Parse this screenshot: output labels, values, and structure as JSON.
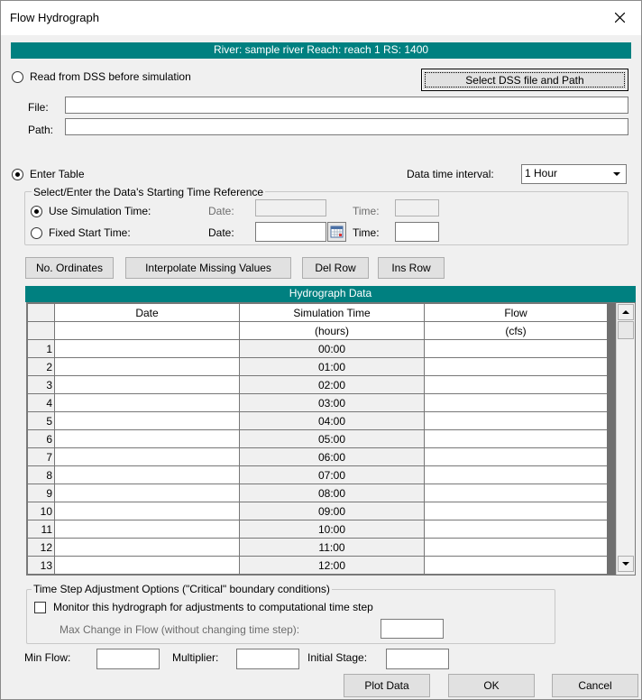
{
  "window": {
    "title": "Flow Hydrograph"
  },
  "header": {
    "location": "River: sample river  Reach: reach 1  RS: 1400"
  },
  "dss": {
    "radio_label": "Read from DSS before simulation",
    "select_button": "Select DSS file and Path",
    "file_label": "File:",
    "file_value": "",
    "path_label": "Path:",
    "path_value": ""
  },
  "enter_table": {
    "radio_label": "Enter Table",
    "interval_label": "Data time interval:",
    "interval_value": "1 Hour"
  },
  "time_ref": {
    "group_title": "Select/Enter the Data's Starting Time Reference",
    "use_sim_label": "Use Simulation Time:",
    "fixed_label": "Fixed Start Time:",
    "date_label": "Date:",
    "time_label": "Time:"
  },
  "toolbar": {
    "ordinates": "No. Ordinates",
    "interpolate": "Interpolate Missing Values",
    "del_row": "Del Row",
    "ins_row": "Ins Row"
  },
  "grid": {
    "title": "Hydrograph Data",
    "col_date": "Date",
    "col_sim": "Simulation Time",
    "col_flow": "Flow",
    "unit_sim": "(hours)",
    "unit_flow": "(cfs)",
    "rows": [
      {
        "n": "1",
        "time": "00:00"
      },
      {
        "n": "2",
        "time": "01:00"
      },
      {
        "n": "3",
        "time": "02:00"
      },
      {
        "n": "4",
        "time": "03:00"
      },
      {
        "n": "5",
        "time": "04:00"
      },
      {
        "n": "6",
        "time": "05:00"
      },
      {
        "n": "7",
        "time": "06:00"
      },
      {
        "n": "8",
        "time": "07:00"
      },
      {
        "n": "9",
        "time": "08:00"
      },
      {
        "n": "10",
        "time": "09:00"
      },
      {
        "n": "11",
        "time": "10:00"
      },
      {
        "n": "12",
        "time": "11:00"
      },
      {
        "n": "13",
        "time": "12:00"
      }
    ]
  },
  "timestep": {
    "group_title": "Time Step Adjustment Options (\"Critical\" boundary conditions)",
    "monitor_label": "Monitor this hydrograph for adjustments to computational time step",
    "max_change_label": "Max Change in Flow (without changing time step):"
  },
  "bottom": {
    "min_flow_label": "Min Flow:",
    "multiplier_label": "Multiplier:",
    "initial_stage_label": "Initial Stage:",
    "plot_button": "Plot Data",
    "ok_button": "OK",
    "cancel_button": "Cancel"
  },
  "colors": {
    "accent": "#008080"
  }
}
